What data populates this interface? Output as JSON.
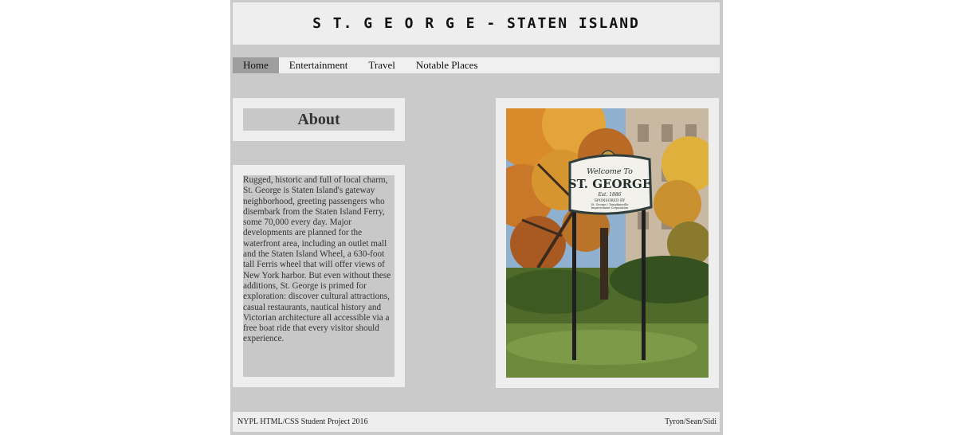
{
  "header": {
    "title": "S T. G E O R G E - STATEN ISLAND"
  },
  "nav": {
    "items": [
      {
        "label": "Home"
      },
      {
        "label": "Entertainment"
      },
      {
        "label": "Travel"
      },
      {
        "label": "Notable Places"
      }
    ]
  },
  "about": {
    "heading": "About",
    "body": "Rugged, historic and full of local charm, St. George is Staten Island's gateway neighborhood, greeting passengers who disembark from the Staten Island Ferry, some 70,000 every day. Major developments are planned for the waterfront area, including an outlet mall and the Staten Island Wheel, a 630-foot tall Ferris wheel that will offer views of New York harbor. But even without these additions, St. George is primed for exploration: discover cultural attractions, casual restaurants, nautical history and Victorian architecture all accessible via a free boat ride that every visitor should experience."
  },
  "photo": {
    "sign": {
      "line1": "Welcome To",
      "line2": "ST. GEORGE",
      "line3": "Est. 1886",
      "line4": "SPONSORED BY",
      "line5": "St. George / Tompkinsville",
      "line6": "Improvement Corporation"
    }
  },
  "footer": {
    "left": "NYPL HTML/CSS Student Project 2016",
    "right": "Tyron/Sean/Sidi"
  }
}
